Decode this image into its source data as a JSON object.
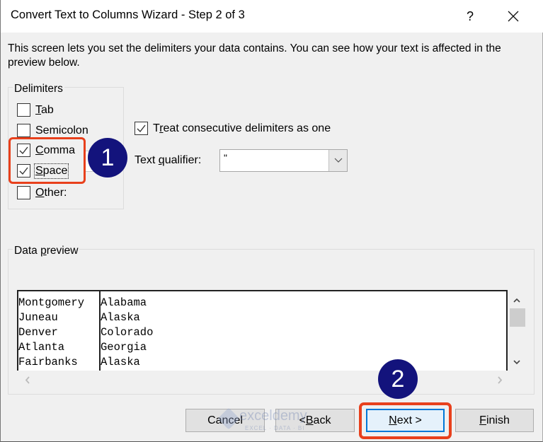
{
  "window": {
    "title": "Convert Text to Columns Wizard - Step 2 of 3",
    "help_label": "?",
    "close_icon": "close-icon"
  },
  "intro_text": "This screen lets you set the delimiters your data contains.  You can see how your text is affected in the preview below.",
  "delimiters": {
    "group_label": "Delimiters",
    "items": [
      {
        "label_u": "T",
        "label_rest": "ab",
        "checked": false
      },
      {
        "label_u": "",
        "label_pre": "Se",
        "label_rest": "micolon",
        "checked": false
      },
      {
        "label_u": "C",
        "label_rest": "omma",
        "checked": true
      },
      {
        "label_u": "S",
        "label_rest": "pace",
        "checked": true
      },
      {
        "label_u": "O",
        "label_rest": "ther:",
        "checked": false
      }
    ],
    "other_value": ""
  },
  "treat_consecutive": {
    "label_pre": "T",
    "label_u": "r",
    "label_rest": "eat consecutive delimiters as one",
    "checked": true
  },
  "text_qualifier": {
    "label_pre": "Text ",
    "label_u": "q",
    "label_rest": "ualifier:",
    "value": "\""
  },
  "preview": {
    "group_label_pre": "Data ",
    "group_label_u": "p",
    "group_label_rest": "review",
    "rows": [
      [
        "Montgomery",
        "Alabama"
      ],
      [
        "Juneau",
        "Alaska"
      ],
      [
        "Denver",
        "Colorado"
      ],
      [
        "Atlanta",
        "Georgia"
      ],
      [
        "Fairbanks",
        "Alaska"
      ]
    ]
  },
  "buttons": {
    "cancel": "Cancel",
    "back_pre": "< ",
    "back_u": "B",
    "back_rest": "ack",
    "next_u": "N",
    "next_rest": "ext >",
    "finish_u": "F",
    "finish_rest": "inish"
  },
  "annotations": {
    "badge1": "1",
    "badge2": "2",
    "highlight_color": "#e8401c",
    "badge_color": "#13137c"
  },
  "watermark": {
    "main": "exceldemy",
    "sub": "EXCEL · DATA · BI"
  }
}
